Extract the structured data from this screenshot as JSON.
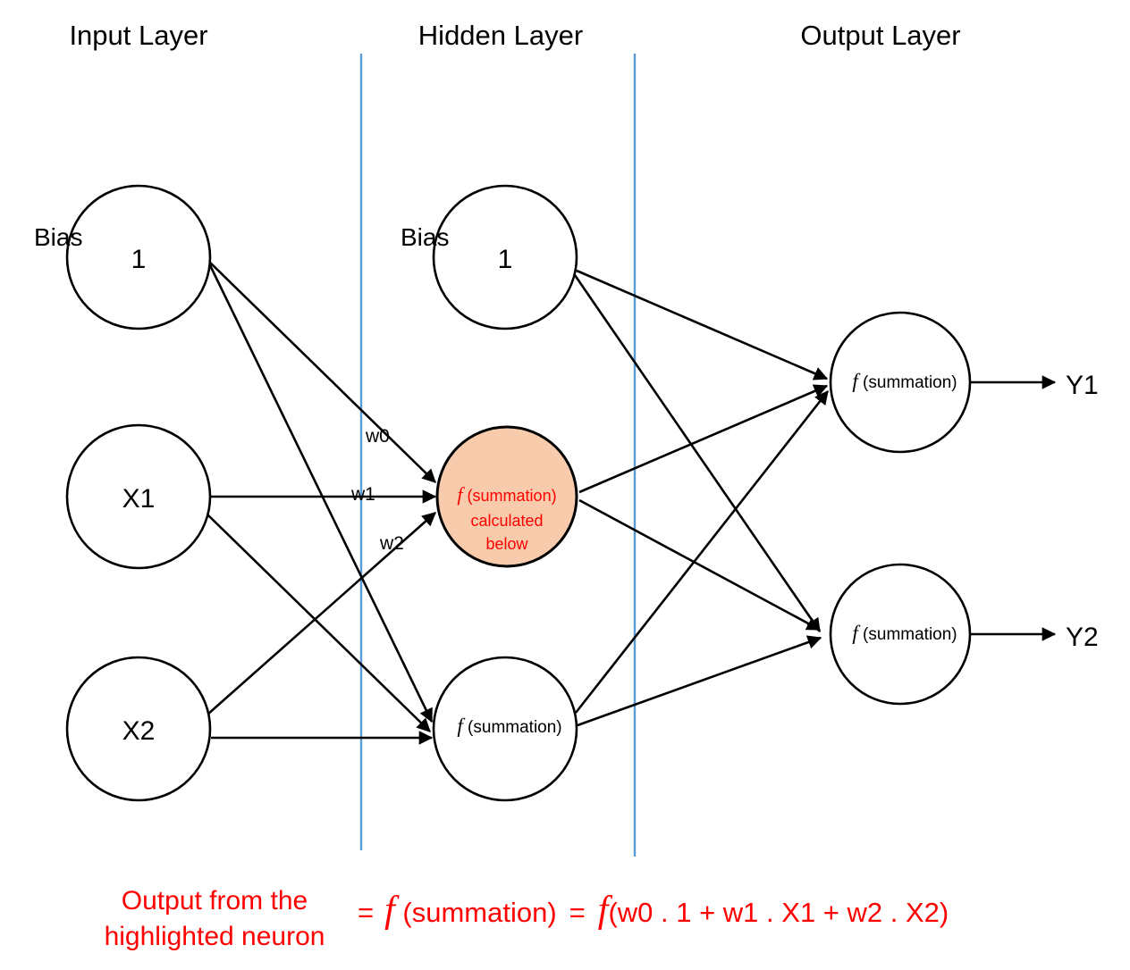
{
  "diagram": {
    "title_row": {
      "input_layer": "Input Layer",
      "hidden_layer": "Hidden Layer",
      "output_layer": "Output Layer"
    },
    "colors": {
      "highlight_fill": "#F7CBAC",
      "divider": "#5B9BD5",
      "accent_text": "#FF0000",
      "edge": "#000000",
      "node_stroke": "#000000"
    },
    "input_layer": {
      "bias_label": "Bias",
      "nodes": [
        {
          "value": "1"
        },
        {
          "value": "X1"
        },
        {
          "value": "X2"
        }
      ]
    },
    "hidden_layer": {
      "bias_label": "Bias",
      "nodes": [
        {
          "value": "1"
        },
        {
          "func_prefix": "f",
          "func_text": " (summation)",
          "line2": "calculated",
          "line3": "below",
          "highlighted": "true"
        },
        {
          "func_prefix": "f",
          "func_text": " (summation)"
        }
      ]
    },
    "output_layer": {
      "nodes": [
        {
          "func_prefix": "f",
          "func_text": " (summation)",
          "out_label": "Y1"
        },
        {
          "func_prefix": "f",
          "func_text": " (summation)",
          "out_label": "Y2"
        }
      ]
    },
    "weights": [
      {
        "label": "w0"
      },
      {
        "label": "w1"
      },
      {
        "label": "w2"
      }
    ],
    "equation": {
      "caption_line1": "Output from the",
      "caption_line2": "highlighted neuron",
      "eq1": "=",
      "f_prefix": "f",
      "summation": " (summation)",
      "eq2": "=",
      "f_prefix2": "f",
      "expression": "(w0 . 1 + w1 . X1 + w2 . X2)"
    }
  }
}
